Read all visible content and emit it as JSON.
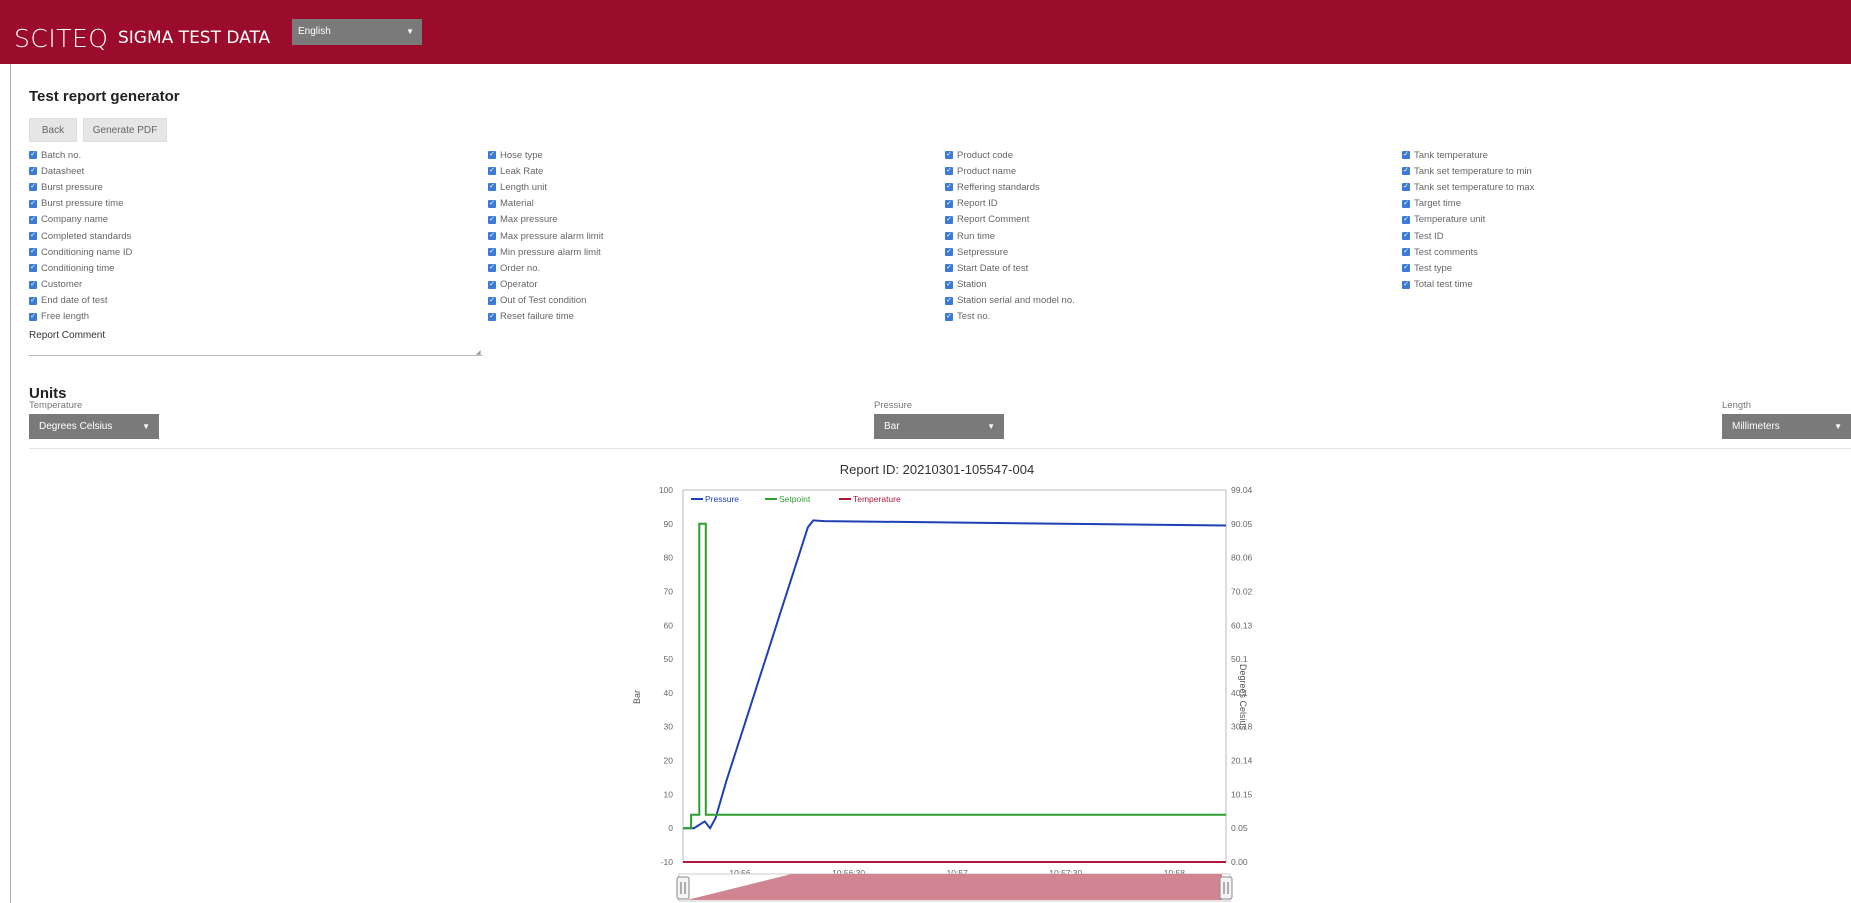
{
  "header": {
    "brand": "SCITEQ",
    "subtitle": "SIGMA TEST DATA",
    "language": "English"
  },
  "page": {
    "title": "Test report generator",
    "back_label": "Back",
    "generate_label": "Generate PDF"
  },
  "checkboxes": {
    "col1": [
      "Batch no.",
      "Datasheet",
      "Burst pressure",
      "Burst pressure time",
      "Company name",
      "Completed standards",
      "Conditioning name ID",
      "Conditioning time",
      "Customer",
      "End date of test",
      "Free length"
    ],
    "col2": [
      "Hose type",
      "Leak Rate",
      "Length unit",
      "Material",
      "Max pressure",
      "Max pressure alarm limit",
      "Min pressure alarm limit",
      "Order no.",
      "Operator",
      "Out of Test condition",
      "Reset failure time"
    ],
    "col3": [
      "Product code",
      "Product name",
      "Reffering standards",
      "Report ID",
      "Report Comment",
      "Run time",
      "Setpressure",
      "Start Date of test",
      "Station",
      "Station serial and model no.",
      "Test no."
    ],
    "col4": [
      "Tank temperature",
      "Tank set temperature to min",
      "Tank set temperature to max",
      "Target time",
      "Temperature unit",
      "Test ID",
      "Test comments",
      "Test type",
      "Total test time"
    ]
  },
  "report_comment": {
    "label": "Report Comment",
    "value": ""
  },
  "units": {
    "title": "Units",
    "temperature": {
      "label": "Temperature",
      "value": "Degrees Celsius"
    },
    "pressure": {
      "label": "Pressure",
      "value": "Bar"
    },
    "length": {
      "label": "Length",
      "value": "Millimeters"
    }
  },
  "colors": {
    "brand": "#9b0b2c",
    "pressure": "#1f3fb5",
    "setpoint": "#2e9e2e",
    "temperature": "#b2183c",
    "checkbox": "#3b7bd4"
  },
  "chart_data": {
    "type": "line",
    "title": "Report ID: 20210301-105547-004",
    "ylabel": "Bar",
    "y2label": "Degrees Celsius",
    "ylim": [
      -10,
      100
    ],
    "yticks": [
      "-10",
      "0",
      "10",
      "20",
      "30",
      "40",
      "50",
      "60",
      "70",
      "80",
      "90",
      "100"
    ],
    "y2ticks": [
      "0.00",
      "0.05",
      "10.15",
      "20.14",
      "30.18",
      "40.1",
      "50.1",
      "60.13",
      "70.02",
      "80.06",
      "90.05",
      "99.04"
    ],
    "xlabels": [
      "10:56",
      "10:56:30",
      "10:57",
      "10:57:30",
      "10:58"
    ],
    "xlim": [
      0,
      100
    ],
    "legend": [
      "Pressure",
      "Setpoint",
      "Temperature"
    ],
    "legend_position": "top-left",
    "grid": true,
    "series": [
      {
        "name": "Pressure",
        "color": "#1f3fb5",
        "x": [
          0,
          2,
          4,
          5,
          6,
          8,
          10,
          12,
          14,
          16,
          18,
          20,
          22,
          23,
          24,
          26,
          100
        ],
        "y": [
          0,
          0,
          2,
          0,
          3,
          14,
          24,
          34,
          44,
          54,
          64,
          74,
          84,
          89,
          91,
          90.8,
          89.5
        ]
      },
      {
        "name": "Setpoint",
        "color": "#2e9e2e",
        "x": [
          0,
          1.5,
          1.5,
          3,
          3,
          4.2,
          4.2,
          100
        ],
        "y": [
          0,
          0,
          4,
          4,
          90,
          90,
          4,
          4
        ]
      },
      {
        "name": "Temperature",
        "color": "#b2183c",
        "x": [
          0,
          100
        ],
        "y": [
          -10,
          -10
        ]
      }
    ]
  }
}
